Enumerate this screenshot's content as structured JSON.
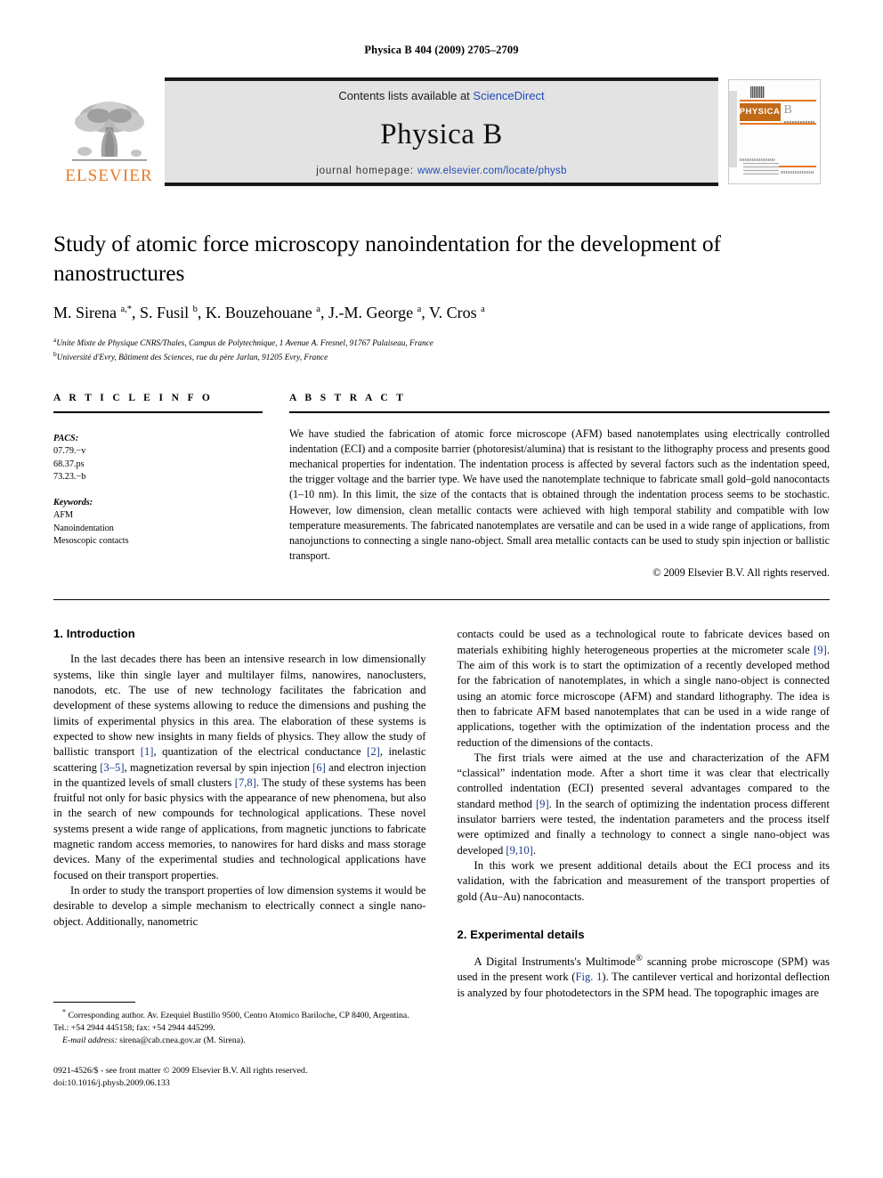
{
  "running_head": "Physica B 404 (2009) 2705–2709",
  "masthead": {
    "contents_prefix": "Contents lists available at ",
    "sciencedirect": "ScienceDirect",
    "journal_name": "Physica B",
    "homepage_prefix": "journal homepage: ",
    "homepage_url": "www.elsevier.com/locate/physb",
    "publisher_wordmark": "ELSEVIER",
    "cover_physica": "PHYSICA",
    "cover_letter": "B",
    "accent_orange": "#E87722",
    "link_blue": "#1f4bb8"
  },
  "title": "Study of atomic force microscopy nanoindentation for the development of nanostructures",
  "authors_html": "M. Sirena <sup>a,</sup><sup>*</sup>, S. Fusil <sup>b</sup>, K. Bouzehouane <sup>a</sup>, J.-M. George <sup>a</sup>, V. Cros <sup>a</sup>",
  "affiliations": [
    {
      "marker": "a",
      "text": "Unite Mixte de Physique CNRS/Thales, Campus de Polytechnique, 1 Avenue A. Fresnel, 91767 Palaiseau, France"
    },
    {
      "marker": "b",
      "text": "Université d'Evry, Bâtiment des Sciences, rue du père Jarlan, 91205 Evry, France"
    }
  ],
  "article_info": {
    "heading": "A R T I C L E  I N F O",
    "pacs_label": "PACS:",
    "pacs": [
      "07.79.−v",
      "68.37.ps",
      "73.23.−b"
    ],
    "keywords_label": "Keywords:",
    "keywords": [
      "AFM",
      "Nanoindentation",
      "Mesoscopic contacts"
    ]
  },
  "abstract": {
    "heading": "A B S T R A C T",
    "text": "We have studied the fabrication of atomic force microscope (AFM) based nanotemplates using electrically controlled indentation (ECI) and a composite barrier (photoresist/alumina) that is resistant to the lithography process and presents good mechanical properties for indentation. The indentation process is affected by several factors such as the indentation speed, the trigger voltage and the barrier type. We have used the nanotemplate technique to fabricate small gold–gold nanocontacts (1–10 nm). In this limit, the size of the contacts that is obtained through the indentation process seems to be stochastic. However, low dimension, clean metallic contacts were achieved with high temporal stability and compatible with low temperature measurements. The fabricated nanotemplates are versatile and can be used in a wide range of applications, from nanojunctions to connecting a single nano-object. Small area metallic contacts can be used to study spin injection or ballistic transport.",
    "copyright": "© 2009 Elsevier B.V. All rights reserved."
  },
  "sections": {
    "intro_title": "1.  Introduction",
    "experimental_title": "2.  Experimental details"
  },
  "paragraphs": {
    "left_1_html": "In the last decades there has been an intensive research in low dimensionally systems, like thin single layer and multilayer films, nanowires, nanoclusters, nanodots, etc. The use of new technology facilitates the fabrication and development of these systems allowing to reduce the dimensions and pushing the limits of experimental physics in this area. The elaboration of these systems is expected to show new insights in many fields of physics. They allow the study of ballistic transport <span class=\"ref\">[1]</span>, quantization of the electrical conductance <span class=\"ref\">[2]</span>, inelastic scattering <span class=\"ref\">[3–5]</span>, magnetization reversal by spin injection <span class=\"ref\">[6]</span> and electron injection in the quantized levels of small clusters <span class=\"ref\">[7,8]</span>. The study of these systems has been fruitful not only for basic physics with the appearance of new phenomena, but also in the search of new compounds for technological applications. These novel systems present a wide range of applications, from magnetic junctions to fabricate magnetic random access memories, to nanowires for hard disks and mass storage devices. Many of the experimental studies and technological applications have focused on their transport properties.",
    "left_2_html": "In order to study the transport properties of low dimension systems it would be desirable to develop a simple mechanism to electrically connect a single nano-object. Additionally, nanometric",
    "right_1_html": "contacts could be used as a technological route to fabricate devices based on materials exhibiting highly heterogeneous properties at the micrometer scale <span class=\"ref\">[9]</span>. The aim of this work is to start the optimization of a recently developed method for the fabrication of nanotemplates, in which a single nano-object is connected using an atomic force microscope (AFM) and standard lithography. The idea is then to fabricate AFM based nanotemplates that can be used in a wide range of applications, together with the optimization of the indentation process and the reduction of the dimensions of the contacts.",
    "right_2_html": "The first trials were aimed at the use and characterization of the AFM “classical” indentation mode. After a short time it was clear that electrically controlled indentation (ECI) presented several advantages compared to the standard method <span class=\"ref\">[9]</span>. In the search of optimizing the indentation process different insulator barriers were tested, the indentation parameters and the process itself were optimized and finally a technology to connect a single nano-object was developed <span class=\"ref\">[9,10]</span>.",
    "right_3_html": "In this work we present additional details about the ECI process and its validation, with the fabrication and measurement of the transport properties of gold (Au–Au) nanocontacts.",
    "right_4_html": "A Digital Instruments's Multimode<sup>®</sup> scanning probe microscope (SPM) was used in the present work (<span class=\"ref\">Fig. 1</span>). The cantilever vertical and horizontal deflection is analyzed by four photodetectors in the SPM head. The topographic images are"
  },
  "footnote_html": "<sup>*</sup> Corresponding author. Av. Ezequiel Bustillo 9500, Centro Atomico Bariloche, CP 8400, Argentina. Tel.: +54 2944 445158; fax: +54 2944 445299.",
  "email_line_html": "<span class=\"em\">E-mail address:</span> sirena@cab.cnea.gov.ar (M. Sirena).",
  "footer": {
    "line1": "0921-4526/$ - see front matter © 2009 Elsevier B.V. All rights reserved.",
    "line2": "doi:10.1016/j.physb.2009.06.133"
  }
}
